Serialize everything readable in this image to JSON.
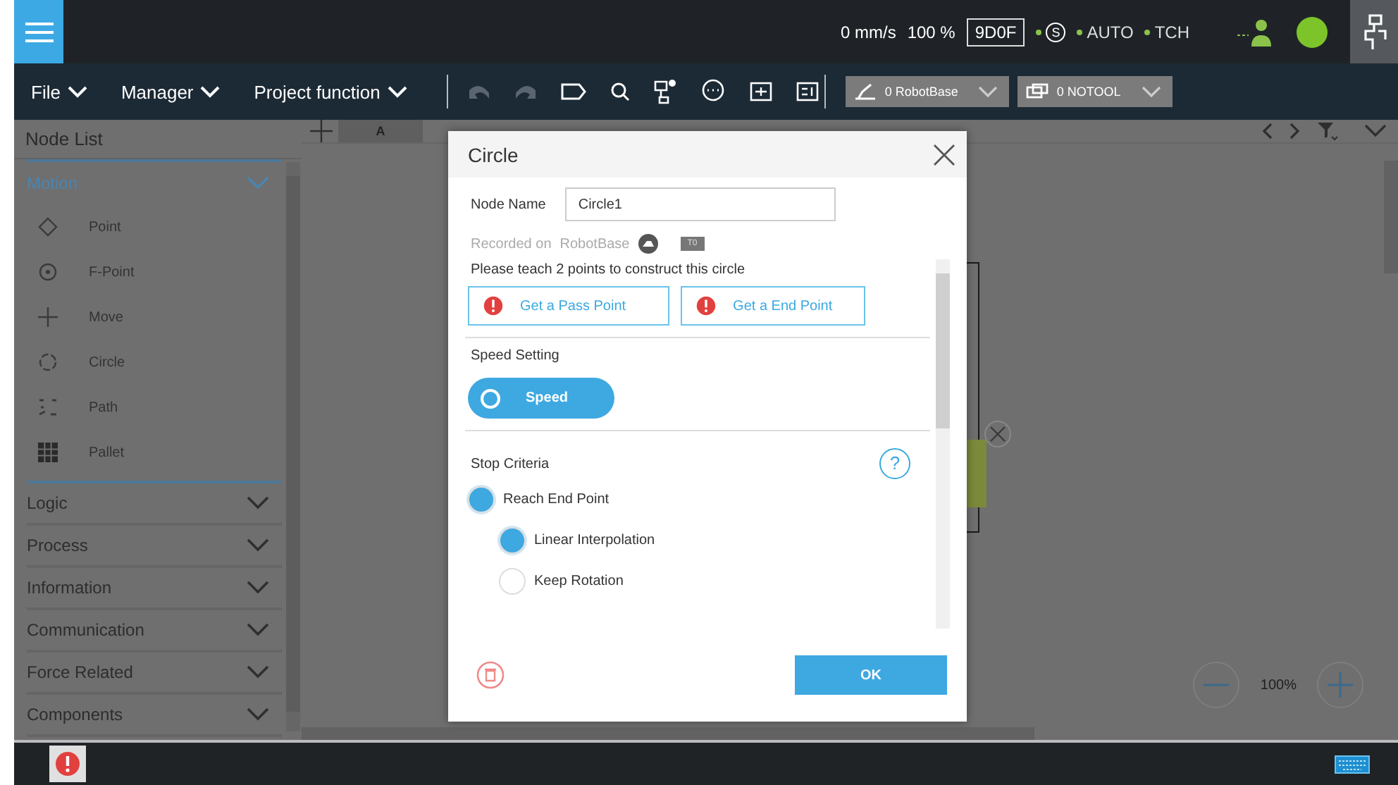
{
  "top_bar": {
    "speed": "0 mm/s",
    "override": "100 %",
    "mode": "9D0F",
    "safety": "S",
    "indicators": [
      "AUTO",
      "TCH"
    ]
  },
  "menu": [
    "File",
    "Manager",
    "Project function"
  ],
  "selectors": {
    "base": "0 RobotBase",
    "tool": "0 NOTOOL"
  },
  "node_list": {
    "title": "Node List",
    "groups": [
      {
        "label": "Motion",
        "expanded": true,
        "children": [
          {
            "label": "Point",
            "kind": "point"
          },
          {
            "label": "F-Point",
            "kind": "fpoint"
          },
          {
            "label": "Move",
            "kind": "move"
          },
          {
            "label": "Circle",
            "kind": "circle"
          },
          {
            "label": "Path",
            "kind": "path"
          },
          {
            "label": "Pallet",
            "kind": "pallet"
          }
        ]
      },
      {
        "label": "Logic",
        "expanded": false
      },
      {
        "label": "Process",
        "expanded": false
      },
      {
        "label": "Information",
        "expanded": false
      },
      {
        "label": "Communication",
        "expanded": false
      },
      {
        "label": "Force Related",
        "expanded": false
      },
      {
        "label": "Components",
        "expanded": false
      }
    ]
  },
  "canvas": {
    "tab": "A",
    "zoom": "100%"
  },
  "dialog": {
    "title": "Circle",
    "node_name_label": "Node Name",
    "node_name": "Circle1",
    "recorded_label": "Recorded on",
    "recorded_frame": "RobotBase",
    "tool_badge": "T0",
    "instruction": "Please teach 2 points to construct this circle",
    "point_buttons": [
      "Get a Pass Point",
      "Get a End Point"
    ],
    "speed_title": "Speed Setting",
    "speed_toggle": "Speed",
    "stop_title": "Stop Criteria",
    "help": "?",
    "stop_options": [
      {
        "label": "Reach End Point",
        "selected": true,
        "children": [
          {
            "label": "Linear Interpolation",
            "selected": true
          },
          {
            "label": "Keep Rotation",
            "selected": false
          }
        ]
      }
    ],
    "ok": "OK"
  }
}
